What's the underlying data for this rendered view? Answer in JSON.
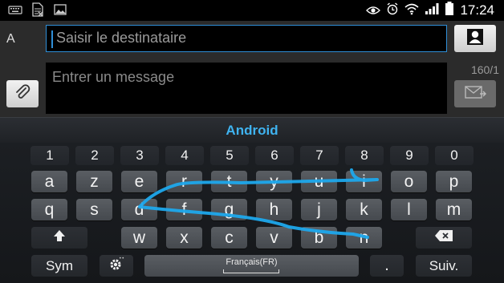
{
  "status_bar": {
    "time": "17:24",
    "icons": [
      "keyboard-icon",
      "sim-card-icon",
      "image-icon",
      "eye-icon",
      "alarm-icon",
      "wifi-icon",
      "signal-icon",
      "battery-icon"
    ]
  },
  "compose": {
    "recipient_label": "A",
    "recipient_placeholder": "Saisir le destinataire",
    "message_placeholder": "Entrer un message",
    "char_counter": "160/1"
  },
  "suggestion": "Android",
  "keyboard": {
    "number_row": [
      "1",
      "2",
      "3",
      "4",
      "5",
      "6",
      "7",
      "8",
      "9",
      "0"
    ],
    "row1": [
      "a",
      "z",
      "e",
      "r",
      "t",
      "y",
      "u",
      "i",
      "o",
      "p"
    ],
    "row2": [
      "q",
      "s",
      "d",
      "f",
      "g",
      "h",
      "j",
      "k",
      "l",
      "m"
    ],
    "row3": [
      "w",
      "x",
      "c",
      "v",
      "b",
      "n"
    ],
    "sym_label": "Sym",
    "space_label": "Français(FR)",
    "period_label": ".",
    "enter_label": "Suiv."
  },
  "colors": {
    "accent": "#2f8fd8",
    "suggestion": "#3fb3f0",
    "swipe_trail": "#1ea8ec"
  }
}
